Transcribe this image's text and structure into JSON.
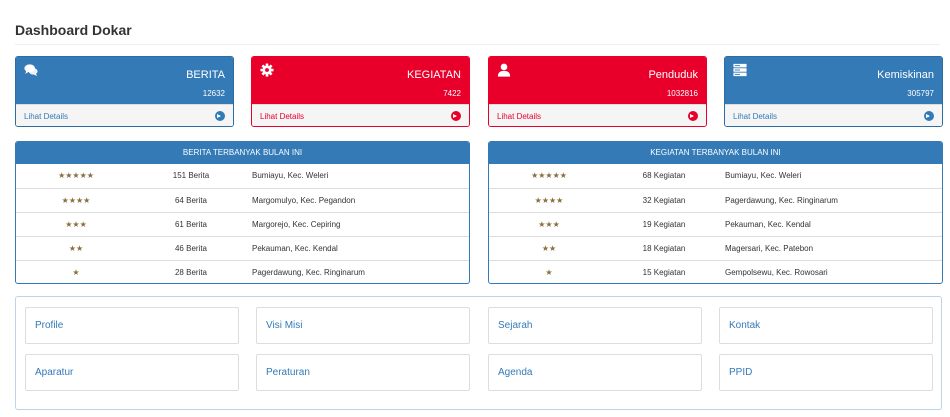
{
  "page": {
    "title": "Dashboard Dokar"
  },
  "stats": [
    {
      "title": "BERITA",
      "count": "12632",
      "link": "Lihat Details",
      "icon": "comments-icon",
      "color": "#337ab7"
    },
    {
      "title": "KEGIATAN",
      "count": "7422",
      "link": "Lihat Details",
      "icon": "gear-icon",
      "color": "#e8002b"
    },
    {
      "title": "Penduduk",
      "count": "1032816",
      "link": "Lihat Details",
      "icon": "user-icon",
      "color": "#e8002b"
    },
    {
      "title": "Kemiskinan",
      "count": "305797",
      "link": "Lihat Details",
      "icon": "server-icon",
      "color": "#337ab7"
    }
  ],
  "berita_rank": {
    "title": "BERITA TERBANYAK BULAN INI",
    "rows": [
      {
        "stars": "★★★★★",
        "count": "151 Berita",
        "place": "Bumiayu, Kec. Weleri"
      },
      {
        "stars": "★★★★",
        "count": "64 Berita",
        "place": "Margomulyo, Kec. Pegandon"
      },
      {
        "stars": "★★★",
        "count": "61 Berita",
        "place": "Margorejo, Kec. Cepiring"
      },
      {
        "stars": "★★",
        "count": "46 Berita",
        "place": "Pekauman, Kec. Kendal"
      },
      {
        "stars": "★",
        "count": "28 Berita",
        "place": "Pagerdawung, Kec. Ringinarum"
      }
    ]
  },
  "kegiatan_rank": {
    "title": "KEGIATAN TERBANYAK BULAN INI",
    "rows": [
      {
        "stars": "★★★★★",
        "count": "68 Kegiatan",
        "place": "Bumiayu, Kec. Weleri"
      },
      {
        "stars": "★★★★",
        "count": "32 Kegiatan",
        "place": "Pagerdawung, Kec. Ringinarum"
      },
      {
        "stars": "★★★",
        "count": "19 Kegiatan",
        "place": "Pekauman, Kec. Kendal"
      },
      {
        "stars": "★★",
        "count": "18 Kegiatan",
        "place": "Magersari, Kec. Patebon"
      },
      {
        "stars": "★",
        "count": "15 Kegiatan",
        "place": "Gempolsewu, Kec. Rowosari"
      }
    ]
  },
  "links": [
    "Profile",
    "Visi Misi",
    "Sejarah",
    "Kontak",
    "Aparatur",
    "Peraturan",
    "Agenda",
    "PPID"
  ],
  "colors": {
    "primary": "#337ab7",
    "danger": "#e8002b",
    "star": "#8a6d3b"
  }
}
